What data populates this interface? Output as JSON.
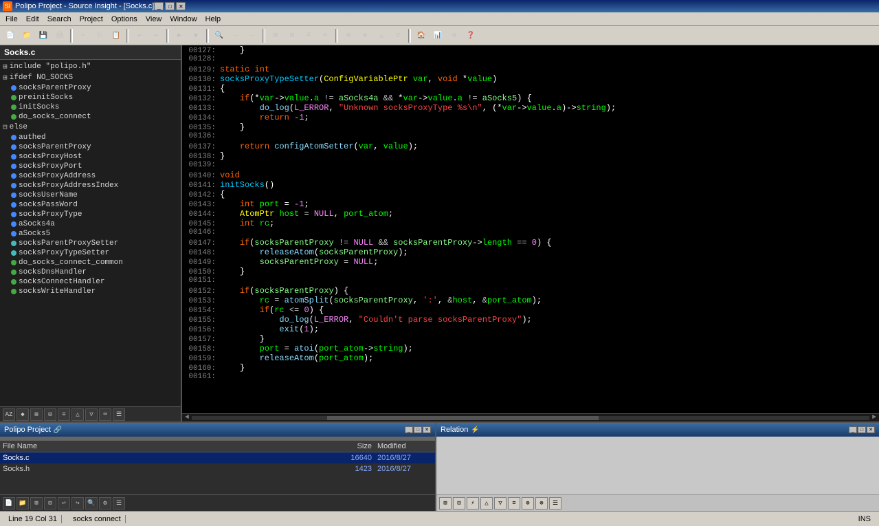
{
  "window": {
    "title": "Polipo Project - Source Insight - [Socks.c]",
    "icon": "SI"
  },
  "menu": {
    "items": [
      "File",
      "Edit",
      "Search",
      "Project",
      "Options",
      "View",
      "Window",
      "Help"
    ]
  },
  "left_panel": {
    "title": "Socks.c",
    "items": [
      {
        "type": "expand",
        "label": "include \"polipo.h\"",
        "indent": 0
      },
      {
        "type": "expand",
        "label": "ifdef NO_SOCKS",
        "indent": 0
      },
      {
        "type": "dot-blue",
        "label": "socksParentProxy",
        "indent": 1
      },
      {
        "type": "dot-green",
        "label": "preinitSocks",
        "indent": 1
      },
      {
        "type": "dot-green",
        "label": "initSocks",
        "indent": 1
      },
      {
        "type": "dot-green",
        "label": "do_socks_connect",
        "indent": 1
      },
      {
        "type": "expand",
        "label": "else",
        "indent": 0
      },
      {
        "type": "dot-blue",
        "label": "authed",
        "indent": 1
      },
      {
        "type": "dot-blue",
        "label": "socksParentProxy",
        "indent": 1
      },
      {
        "type": "dot-blue",
        "label": "socksProxyHost",
        "indent": 1
      },
      {
        "type": "dot-blue",
        "label": "socksProxyPort",
        "indent": 1
      },
      {
        "type": "dot-blue",
        "label": "socksProxyAddress",
        "indent": 1
      },
      {
        "type": "dot-blue",
        "label": "socksProxyAddressIndex",
        "indent": 1
      },
      {
        "type": "dot-blue",
        "label": "socksUserName",
        "indent": 1
      },
      {
        "type": "dot-blue",
        "label": "socksPassWord",
        "indent": 1
      },
      {
        "type": "dot-blue",
        "label": "socksProxyType",
        "indent": 1
      },
      {
        "type": "dot-blue",
        "label": "aSocks4a",
        "indent": 1
      },
      {
        "type": "dot-blue",
        "label": "aSocks5",
        "indent": 1
      },
      {
        "type": "dot-cyan",
        "label": "socksParentProxySetter",
        "indent": 1
      },
      {
        "type": "dot-cyan",
        "label": "socksProxyTypeSetter",
        "indent": 1
      },
      {
        "type": "dot-green",
        "label": "do_socks_connect_common",
        "indent": 1
      },
      {
        "type": "dot-green",
        "label": "socksDnsHandler",
        "indent": 1
      },
      {
        "type": "dot-green",
        "label": "socksConnectHandler",
        "indent": 1
      },
      {
        "type": "dot-green",
        "label": "socksWriteHandler",
        "indent": 1
      }
    ]
  },
  "tree_toolbar": {
    "buttons": [
      "AZ",
      "◆",
      "⊞",
      "⊟",
      "≡",
      "△",
      "▽",
      "⌨",
      "☰"
    ]
  },
  "code": {
    "lines": [
      {
        "num": "00127:",
        "content": "    }"
      },
      {
        "num": "00128:",
        "content": ""
      },
      {
        "num": "00129:",
        "content": "static int"
      },
      {
        "num": "00130:",
        "content": "socksProxyTypeSetter(ConfigVariablePtr var, void *value)"
      },
      {
        "num": "00131:",
        "content": "{"
      },
      {
        "num": "00132:",
        "content": "    if(*var->value.a != aSocks4a && *var->value.a != aSocks5) {"
      },
      {
        "num": "00133:",
        "content": "        do_log(L_ERROR, \"Unknown socksProxyType %s\\n\", (*var->value.a)->string);"
      },
      {
        "num": "00134:",
        "content": "        return -1;"
      },
      {
        "num": "00135:",
        "content": "    }"
      },
      {
        "num": "00136:",
        "content": ""
      },
      {
        "num": "00137:",
        "content": "    return configAtomSetter(var, value);"
      },
      {
        "num": "00138:",
        "content": "}"
      },
      {
        "num": "00139:",
        "content": ""
      },
      {
        "num": "00140:",
        "content": "void"
      },
      {
        "num": "00141:",
        "content": "initSocks()"
      },
      {
        "num": "00142:",
        "content": "{"
      },
      {
        "num": "00143:",
        "content": "    int port = -1;"
      },
      {
        "num": "00144:",
        "content": "    AtomPtr host = NULL, port_atom;"
      },
      {
        "num": "00145:",
        "content": "    int rc;"
      },
      {
        "num": "00146:",
        "content": ""
      },
      {
        "num": "00147:",
        "content": "    if(socksParentProxy != NULL && socksParentProxy->length == 0) {"
      },
      {
        "num": "00148:",
        "content": "        releaseAtom(socksParentProxy);"
      },
      {
        "num": "00149:",
        "content": "        socksParentProxy = NULL;"
      },
      {
        "num": "00150:",
        "content": "    }"
      },
      {
        "num": "00151:",
        "content": ""
      },
      {
        "num": "00152:",
        "content": "    if(socksParentProxy) {"
      },
      {
        "num": "00153:",
        "content": "        rc = atomSplit(socksParentProxy, ':', &host, &port_atom);"
      },
      {
        "num": "00154:",
        "content": "        if(rc <= 0) {"
      },
      {
        "num": "00155:",
        "content": "            do_log(L_ERROR, \"Couldn't parse socksParentProxy\");"
      },
      {
        "num": "00156:",
        "content": "            exit(1);"
      },
      {
        "num": "00157:",
        "content": "        }"
      },
      {
        "num": "00158:",
        "content": "        port = atoi(port_atom->string);"
      },
      {
        "num": "00159:",
        "content": "        releaseAtom(port_atom);"
      },
      {
        "num": "00160:",
        "content": "    }"
      },
      {
        "num": "00161:",
        "content": ""
      }
    ]
  },
  "bottom_panels": {
    "project": {
      "title": "Polipo Project",
      "file_header": {
        "name": "File Name",
        "size": "Size",
        "modified": "Modified"
      },
      "files": [
        {
          "name": "Socks.c",
          "size": "16640",
          "modified": "2016/8/27",
          "selected": true
        },
        {
          "name": "Socks.h",
          "size": "1423",
          "modified": "2016/8/27",
          "selected": false
        }
      ]
    },
    "relation": {
      "title": "Relation"
    }
  },
  "status_bar": {
    "position": "Line 19  Col 31",
    "ins": "INS"
  },
  "search_label": "Search",
  "socks_connect_label": "socks connect"
}
